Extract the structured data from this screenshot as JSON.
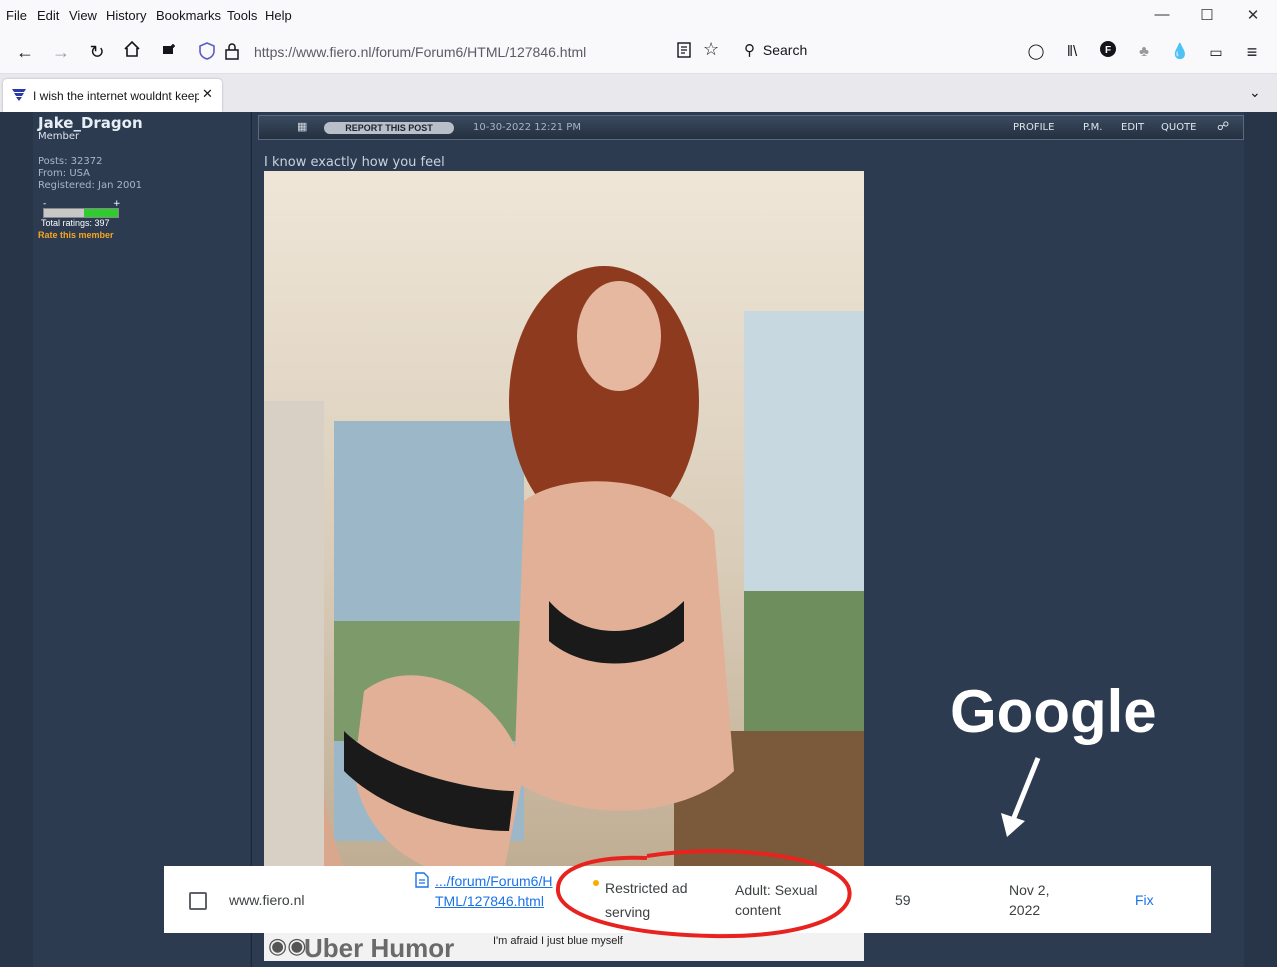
{
  "menu": [
    "File",
    "Edit",
    "View",
    "History",
    "Bookmarks",
    "Tools",
    "Help"
  ],
  "window_controls": {
    "minimize": "—",
    "maximize": "☐",
    "close": "✕"
  },
  "nav": {
    "url": "https://www.fiero.nl/forum/Forum6/HTML/127846.html",
    "search_placeholder": "Search"
  },
  "tab": {
    "title": "I wish the internet wouldnt keep",
    "close": "✕"
  },
  "sidebar": {
    "username": "Jake_Dragon",
    "rank": "Member",
    "posts": "Posts: 32372",
    "from": "From: USA",
    "registered": "Registered: Jan 2001",
    "rating_minus": "-",
    "rating_plus": "+",
    "total_ratings": "Total ratings: 397",
    "rate_link": "Rate this member",
    "rating_fraction": 0.46
  },
  "post": {
    "report_label": "REPORT THIS POST",
    "date": "10-30-2022 12:21 PM",
    "links": [
      "PROFILE",
      "P.M.",
      "EDIT",
      "QUOTE"
    ],
    "text": "I know exactly how you feel",
    "uber_title": "Uber Humor",
    "uber_caption": "I'm afraid I just blue myself"
  },
  "annotation": {
    "label": "Google"
  },
  "search_console_row": {
    "site": "www.fiero.nl",
    "url": ".../forum/Forum6/HTML/127846.html",
    "issue": "Restricted ad serving",
    "reason": "Adult: Sexual content",
    "count": "59",
    "date": "Nov 2, 2022",
    "action": "Fix",
    "issue_dot_color": "#f9ab00"
  }
}
